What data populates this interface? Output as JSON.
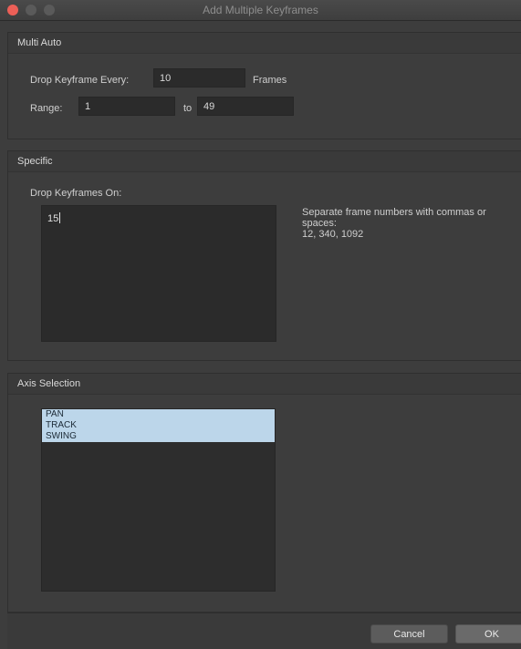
{
  "window": {
    "title": "Add Multiple Keyframes"
  },
  "multi_auto": {
    "section_title": "Multi Auto",
    "drop_every_label": "Drop Keyframe Every:",
    "drop_every_value": "10",
    "frames_label": "Frames",
    "range_label": "Range:",
    "range_from": "1",
    "range_to_label": "to",
    "range_to": "49"
  },
  "specific": {
    "section_title": "Specific",
    "drop_on_label": "Drop Keyframes On:",
    "drop_on_value": "15",
    "hint_line1": "Separate frame numbers with commas or",
    "hint_line2": "spaces:",
    "hint_line3": "12, 340, 1092"
  },
  "axis_selection": {
    "section_title": "Axis Selection",
    "items": [
      "PAN",
      "TRACK",
      "SWING"
    ],
    "selected_color": "#bcd6ea"
  },
  "buttons": {
    "cancel_label": "Cancel",
    "ok_label": "OK"
  },
  "colors": {
    "close_button": "#ec5f57",
    "window_bg": "#3d3d3d"
  }
}
